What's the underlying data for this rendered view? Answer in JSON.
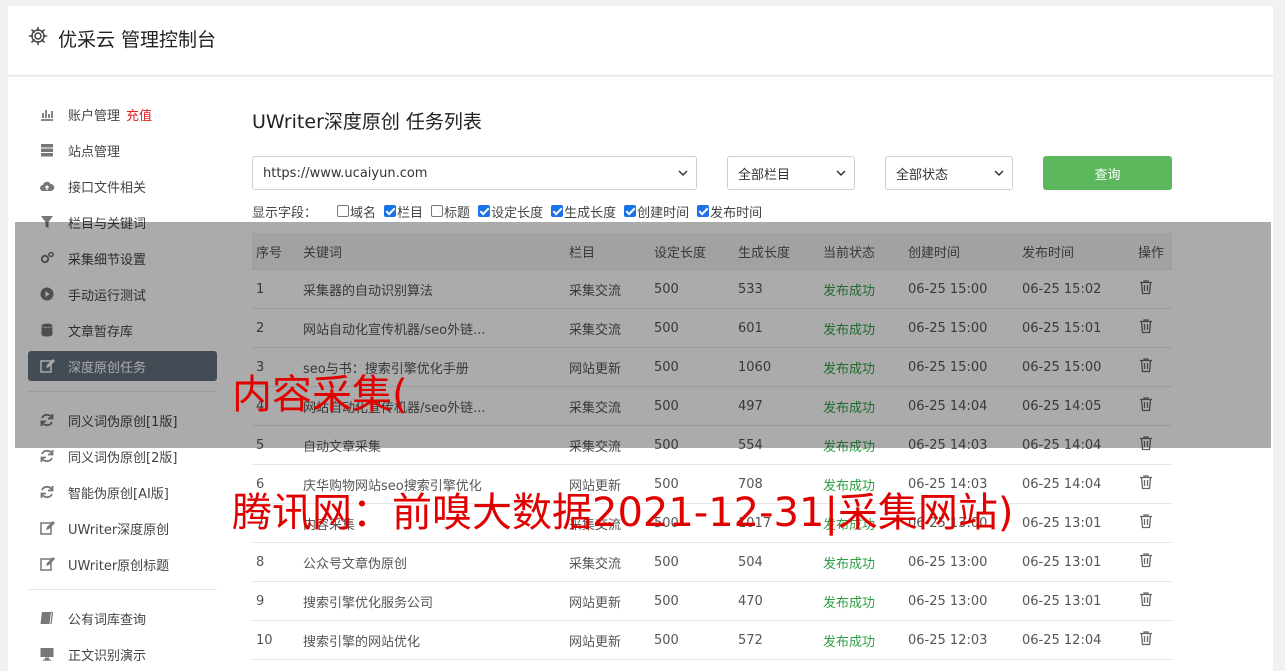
{
  "app": {
    "title": "优采云 管理控制台"
  },
  "sidebar": {
    "group1": [
      {
        "label": "账户管理",
        "badge": "充值",
        "icon": "bar-chart-icon"
      },
      {
        "label": "站点管理",
        "icon": "server-icon"
      },
      {
        "label": "接口文件相关",
        "icon": "cloud-upload-icon"
      },
      {
        "label": "栏目与关键词",
        "icon": "filter-icon"
      },
      {
        "label": "采集细节设置",
        "icon": "gears-icon"
      },
      {
        "label": "手动运行测试",
        "icon": "play-circle-icon"
      },
      {
        "label": "文章暂存库",
        "icon": "database-icon"
      },
      {
        "label": "深度原创任务",
        "icon": "edit-icon",
        "active": true
      }
    ],
    "group2": [
      {
        "label": "同义词伪原创[1版]",
        "icon": "refresh-icon"
      },
      {
        "label": "同义词伪原创[2版]",
        "icon": "refresh-icon"
      },
      {
        "label": "智能伪原创[AI版]",
        "icon": "refresh-icon"
      },
      {
        "label": "UWriter深度原创",
        "icon": "edit-icon"
      },
      {
        "label": "UWriter原创标题",
        "icon": "edit-icon"
      }
    ],
    "group3": [
      {
        "label": "公有词库查询",
        "icon": "book-icon"
      },
      {
        "label": "正文识别演示",
        "icon": "monitor-icon"
      }
    ]
  },
  "main": {
    "title": "UWriter深度原创 任务列表",
    "filters": {
      "site": "https://www.ucaiyun.com",
      "column": "全部栏目",
      "status": "全部状态",
      "query_label": "查询"
    },
    "fields_label": "显示字段：",
    "fields": [
      {
        "label": "域名",
        "checked": false
      },
      {
        "label": "栏目",
        "checked": true
      },
      {
        "label": "标题",
        "checked": false
      },
      {
        "label": "设定长度",
        "checked": true
      },
      {
        "label": "生成长度",
        "checked": true
      },
      {
        "label": "创建时间",
        "checked": true
      },
      {
        "label": "发布时间",
        "checked": true
      }
    ],
    "table": {
      "headers": [
        "序号",
        "关键词",
        "栏目",
        "设定长度",
        "生成长度",
        "当前状态",
        "创建时间",
        "发布时间",
        "操作"
      ],
      "rows": [
        [
          "1",
          "采集器的自动识别算法",
          "采集交流",
          "500",
          "533",
          "发布成功",
          "06-25 15:00",
          "06-25 15:02"
        ],
        [
          "2",
          "网站自动化宣传机器/seo外链...",
          "采集交流",
          "500",
          "601",
          "发布成功",
          "06-25 15:00",
          "06-25 15:01"
        ],
        [
          "3",
          "seo与书：搜索引擎优化手册",
          "网站更新",
          "500",
          "1060",
          "发布成功",
          "06-25 15:00",
          "06-25 15:00"
        ],
        [
          "4",
          "网站自动化宣传机器/seo外链...",
          "采集交流",
          "500",
          "497",
          "发布成功",
          "06-25 14:04",
          "06-25 14:05"
        ],
        [
          "5",
          "自动文章采集",
          "采集交流",
          "500",
          "554",
          "发布成功",
          "06-25 14:03",
          "06-25 14:04"
        ],
        [
          "6",
          "庆华购物网站seo搜索引擎优化",
          "网站更新",
          "500",
          "708",
          "发布成功",
          "06-25 14:03",
          "06-25 14:04"
        ],
        [
          "7",
          "内容采集",
          "采集交流",
          "500",
          "1017",
          "发布成功",
          "06-25 13:00",
          "06-25 13:01"
        ],
        [
          "8",
          "公众号文章伪原创",
          "采集交流",
          "500",
          "504",
          "发布成功",
          "06-25 13:00",
          "06-25 13:01"
        ],
        [
          "9",
          "搜索引擎优化服务公司",
          "网站更新",
          "500",
          "470",
          "发布成功",
          "06-25 13:00",
          "06-25 13:01"
        ],
        [
          "10",
          "搜索引擎的网站优化",
          "网站更新",
          "500",
          "572",
          "发布成功",
          "06-25 12:03",
          "06-25 12:04"
        ]
      ]
    }
  },
  "watermark": {
    "line1": "内容采集(",
    "line2": "腾讯网：前嗅大数据2021-12-31|采集网站)"
  },
  "colors": {
    "accent": "#5cb85c",
    "active_nav": "#64717f",
    "status_ok": "#2ea043",
    "badge": "#e02020",
    "watermark": "#e10000"
  }
}
